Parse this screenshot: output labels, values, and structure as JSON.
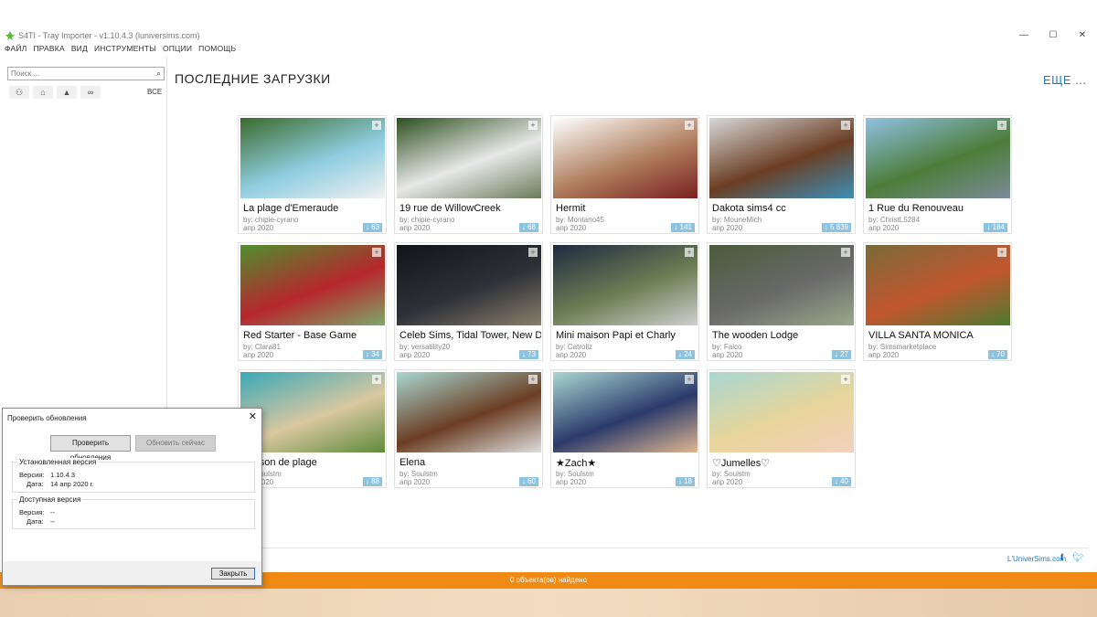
{
  "window": {
    "title": "S4TI - Tray Importer - v1.10.4.3 (luniversims.com)",
    "minimize": "—",
    "maximize": "☐",
    "close": "✕"
  },
  "menu": [
    "ФАЙЛ",
    "ПРАВКА",
    "ВИД",
    "ИНСТРУМЕНТЫ",
    "ОПЦИИ",
    "ПОМОЩЬ"
  ],
  "sidebar": {
    "search_placeholder": "Поиск ...",
    "filter_all": "ВСЕ",
    "filter_icons": [
      "sims-filter-icon",
      "households-filter-icon",
      "lots-filter-icon",
      "infinity-filter-icon"
    ]
  },
  "main": {
    "title": "ПОСЛЕДНИЕ ЗАГРУЗКИ",
    "more": "ЕЩЕ ..."
  },
  "cards": [
    {
      "name": "La plage d'Emeraude",
      "by": "by: chipie-cyrano",
      "date": "апр 2020",
      "downloads": "63",
      "colors": [
        "#3a6b2c",
        "#8fcde0",
        "#f1f1f1"
      ]
    },
    {
      "name": "19 rue de WillowCreek",
      "by": "by: chipie-cyrano",
      "date": "апр 2020",
      "downloads": "68",
      "colors": [
        "#2d4f1f",
        "#e8e8e8",
        "#6a7b5a"
      ]
    },
    {
      "name": "Hermit",
      "by": "by: Montano45",
      "date": "апр 2020",
      "downloads": "141",
      "colors": [
        "#ffffff",
        "#b07f5f",
        "#7a1f1f"
      ]
    },
    {
      "name": "Dakota sims4 cc",
      "by": "by: MouneMich",
      "date": "апр 2020",
      "downloads": "5 839",
      "colors": [
        "#d8d8d8",
        "#6b3e23",
        "#3c8fb8"
      ]
    },
    {
      "name": "1 Rue du Renouveau",
      "by": "by: ChristL5284",
      "date": "апр 2020",
      "downloads": "184",
      "colors": [
        "#8fc1e3",
        "#4d7d3a",
        "#7a8b99"
      ]
    },
    {
      "name": "Red Starter - Base Game",
      "by": "by: Clara81",
      "date": "апр 2020",
      "downloads": "34",
      "colors": [
        "#4f8f2f",
        "#b7262d",
        "#7ea86a"
      ]
    },
    {
      "name": "Celeb Sims, Tidal Tower, New Dr",
      "by": "by: versatility20",
      "date": "апр 2020",
      "downloads": "73",
      "colors": [
        "#111418",
        "#2e3138",
        "#8a7e6a"
      ]
    },
    {
      "name": "Mini maison Papi et Charly",
      "by": "by: Catrollz",
      "date": "апр 2020",
      "downloads": "24",
      "colors": [
        "#1f2a40",
        "#6d7f55",
        "#cfcfcf"
      ]
    },
    {
      "name": "The wooden Lodge",
      "by": "by: Falco",
      "date": "апр 2020",
      "downloads": "27",
      "colors": [
        "#4a5b3a",
        "#6a6a6a",
        "#9aa88a"
      ]
    },
    {
      "name": "VILLA SANTA MONICA",
      "by": "by: Simsmarketplace",
      "date": "апр 2020",
      "downloads": "70",
      "colors": [
        "#7a6a3a",
        "#c2562f",
        "#4e7a2f"
      ]
    },
    {
      "name": "Maison de plage",
      "by": "by: Soulstm",
      "date": "апр 2020",
      "downloads": "88",
      "colors": [
        "#3aa8b8",
        "#d9c8a0",
        "#5f8a3a"
      ]
    },
    {
      "name": "Elena",
      "by": "by: Soulstm",
      "date": "апр 2020",
      "downloads": "60",
      "colors": [
        "#a9d7d2",
        "#6b3e23",
        "#dedede"
      ]
    },
    {
      "name": "★Zach★",
      "by": "by: Soulstm",
      "date": "апр 2020",
      "downloads": "18",
      "colors": [
        "#a9d7d2",
        "#2b3a6b",
        "#e0b890"
      ]
    },
    {
      "name": "♡Jumelles♡",
      "by": "by: Soulstm",
      "date": "апр 2020",
      "downloads": "40",
      "colors": [
        "#a9d7d2",
        "#e8d59a",
        "#f2d0c0"
      ]
    }
  ],
  "footer": {
    "link": "L'UniverSims.com",
    "status": "0 объекта(ов) найдено"
  },
  "dialog": {
    "title": "Проверить обновления",
    "check_button": "Проверить обновления",
    "update_button": "Обновить сейчас",
    "installed_group": "Установленная версия",
    "installed_version_label": "Версия:",
    "installed_version": "1.10.4.3",
    "installed_date_label": "Дата:",
    "installed_date": "14 апр 2020 г.",
    "available_group": "Доступная версия",
    "available_version_label": "Версия:",
    "available_version": "--",
    "available_date_label": "Дата:",
    "available_date": "--",
    "close_button": "Закрыть"
  }
}
